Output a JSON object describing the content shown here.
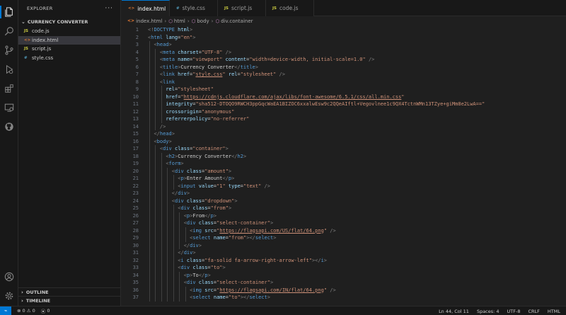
{
  "explorer": {
    "title": "EXPLORER",
    "more": "···",
    "folder": "CURRENCY CONVERTER",
    "files": [
      {
        "name": "code.js",
        "icon": "JS"
      },
      {
        "name": "index.html",
        "icon": "<>"
      },
      {
        "name": "script.js",
        "icon": "JS"
      },
      {
        "name": "style.css",
        "icon": "#"
      }
    ],
    "outline": "OUTLINE",
    "timeline": "TIMELINE"
  },
  "tabs": [
    {
      "name": "index.html",
      "icon": "<>",
      "close": "×"
    },
    {
      "name": "style.css",
      "icon": "#"
    },
    {
      "name": "script.js",
      "icon": "JS"
    },
    {
      "name": "code.js",
      "icon": "JS"
    }
  ],
  "breadcrumb": [
    "index.html",
    "html",
    "body",
    "div.container"
  ],
  "statusbar": {
    "errors": "0",
    "warnings": "0",
    "ports": "0",
    "position": "Ln 44, Col 11",
    "spaces": "Spaces: 4",
    "encoding": "UTF-8",
    "eol": "CRLF",
    "language": "HTML"
  },
  "colors": {
    "accent": "#0078d4",
    "tag": "#569cd6",
    "attribute": "#9cdcfe",
    "string": "#ce9178"
  },
  "editor": {
    "lines": [
      {
        "n": "1",
        "indent": 0,
        "tokens": [
          [
            "br",
            "<!"
          ],
          [
            "tag",
            "DOCTYPE"
          ],
          [
            "attr",
            " html"
          ],
          [
            "br",
            ">"
          ]
        ]
      },
      {
        "n": "2",
        "indent": 0,
        "tokens": [
          [
            "br",
            "<"
          ],
          [
            "tag",
            "html"
          ],
          [
            "attr",
            " lang"
          ],
          [
            "txt",
            "="
          ],
          [
            "str",
            "\"en\""
          ],
          [
            "br",
            ">"
          ]
        ]
      },
      {
        "n": "3",
        "indent": 1,
        "tokens": [
          [
            "br",
            "<"
          ],
          [
            "tag",
            "head"
          ],
          [
            "br",
            ">"
          ]
        ]
      },
      {
        "n": "4",
        "indent": 2,
        "tokens": [
          [
            "br",
            "<"
          ],
          [
            "tag",
            "meta"
          ],
          [
            "attr",
            " charset"
          ],
          [
            "txt",
            "="
          ],
          [
            "str",
            "\"UTF-8\""
          ],
          [
            "br",
            " />"
          ]
        ]
      },
      {
        "n": "5",
        "indent": 2,
        "tokens": [
          [
            "br",
            "<"
          ],
          [
            "tag",
            "meta"
          ],
          [
            "attr",
            " name"
          ],
          [
            "txt",
            "="
          ],
          [
            "str",
            "\"viewport\""
          ],
          [
            "attr",
            " content"
          ],
          [
            "txt",
            "="
          ],
          [
            "str",
            "\"width=device-width, initial-scale=1.0\""
          ],
          [
            "br",
            " />"
          ]
        ]
      },
      {
        "n": "6",
        "indent": 2,
        "tokens": [
          [
            "br",
            "<"
          ],
          [
            "tag",
            "title"
          ],
          [
            "br",
            ">"
          ],
          [
            "txt",
            "Currency Converter"
          ],
          [
            "br",
            "</"
          ],
          [
            "tag",
            "title"
          ],
          [
            "br",
            ">"
          ]
        ]
      },
      {
        "n": "7",
        "indent": 2,
        "tokens": [
          [
            "br",
            "<"
          ],
          [
            "tag",
            "link"
          ],
          [
            "attr",
            " href"
          ],
          [
            "txt",
            "="
          ],
          [
            "str",
            "\""
          ],
          [
            "link",
            "style.css"
          ],
          [
            "str",
            "\""
          ],
          [
            "attr",
            " rel"
          ],
          [
            "txt",
            "="
          ],
          [
            "str",
            "\"stylesheet\""
          ],
          [
            "br",
            " />"
          ]
        ]
      },
      {
        "n": "8",
        "indent": 2,
        "tokens": [
          [
            "br",
            "<"
          ],
          [
            "tag",
            "link"
          ]
        ]
      },
      {
        "n": "9",
        "indent": 3,
        "tokens": [
          [
            "attr",
            "rel"
          ],
          [
            "txt",
            "="
          ],
          [
            "str",
            "\"stylesheet\""
          ]
        ]
      },
      {
        "n": "10",
        "indent": 3,
        "tokens": [
          [
            "attr",
            "href"
          ],
          [
            "txt",
            "="
          ],
          [
            "str",
            "\""
          ],
          [
            "link",
            "https://cdnjs.cloudflare.com/ajax/libs/font-awesome/6.5.1/css/all.min.css"
          ],
          [
            "str",
            "\""
          ]
        ]
      },
      {
        "n": "11",
        "indent": 3,
        "tokens": [
          [
            "attr",
            "integrity"
          ],
          [
            "txt",
            "="
          ],
          [
            "str",
            "\"sha512-DTOQO9RWCH3ppGqcWaEA1BIZOC6xxalwEsw9c2QQeAIftl+Vegovlnee1c9QX4TctnWMn13TZye+giMm8e2LwA==\""
          ]
        ]
      },
      {
        "n": "12",
        "indent": 3,
        "tokens": [
          [
            "attr",
            "crossorigin"
          ],
          [
            "txt",
            "="
          ],
          [
            "str",
            "\"anonymous\""
          ]
        ]
      },
      {
        "n": "13",
        "indent": 3,
        "tokens": [
          [
            "attr",
            "referrerpolicy"
          ],
          [
            "txt",
            "="
          ],
          [
            "str",
            "\"no-referrer\""
          ]
        ]
      },
      {
        "n": "14",
        "indent": 2,
        "tokens": [
          [
            "br",
            "/>"
          ]
        ]
      },
      {
        "n": "15",
        "indent": 1,
        "tokens": [
          [
            "br",
            "</"
          ],
          [
            "tag",
            "head"
          ],
          [
            "br",
            ">"
          ]
        ]
      },
      {
        "n": "16",
        "indent": 1,
        "tokens": [
          [
            "br",
            "<"
          ],
          [
            "tag",
            "body"
          ],
          [
            "br",
            ">"
          ]
        ]
      },
      {
        "n": "17",
        "indent": 2,
        "tokens": [
          [
            "br",
            "<"
          ],
          [
            "tag",
            "div"
          ],
          [
            "attr",
            " class"
          ],
          [
            "txt",
            "="
          ],
          [
            "str",
            "\"container\""
          ],
          [
            "br",
            ">"
          ]
        ]
      },
      {
        "n": "18",
        "indent": 3,
        "tokens": [
          [
            "br",
            "<"
          ],
          [
            "tag",
            "h2"
          ],
          [
            "br",
            ">"
          ],
          [
            "txt",
            "Currency Converter"
          ],
          [
            "br",
            "</"
          ],
          [
            "tag",
            "h2"
          ],
          [
            "br",
            ">"
          ]
        ]
      },
      {
        "n": "19",
        "indent": 3,
        "tokens": [
          [
            "br",
            "<"
          ],
          [
            "tag",
            "form"
          ],
          [
            "br",
            ">"
          ]
        ]
      },
      {
        "n": "20",
        "indent": 4,
        "tokens": [
          [
            "br",
            "<"
          ],
          [
            "tag",
            "div"
          ],
          [
            "attr",
            " class"
          ],
          [
            "txt",
            "="
          ],
          [
            "str",
            "\"amount\""
          ],
          [
            "br",
            ">"
          ]
        ]
      },
      {
        "n": "21",
        "indent": 5,
        "tokens": [
          [
            "br",
            "<"
          ],
          [
            "tag",
            "p"
          ],
          [
            "br",
            ">"
          ],
          [
            "txt",
            "Enter Amount"
          ],
          [
            "br",
            "</"
          ],
          [
            "tag",
            "p"
          ],
          [
            "br",
            ">"
          ]
        ]
      },
      {
        "n": "22",
        "indent": 5,
        "tokens": [
          [
            "br",
            "<"
          ],
          [
            "tag",
            "input"
          ],
          [
            "attr",
            " value"
          ],
          [
            "txt",
            "="
          ],
          [
            "str",
            "\"1\""
          ],
          [
            "attr",
            " type"
          ],
          [
            "txt",
            "="
          ],
          [
            "str",
            "\"text\""
          ],
          [
            "br",
            " />"
          ]
        ]
      },
      {
        "n": "23",
        "indent": 4,
        "tokens": [
          [
            "br",
            "</"
          ],
          [
            "tag",
            "div"
          ],
          [
            "br",
            ">"
          ]
        ]
      },
      {
        "n": "24",
        "indent": 4,
        "tokens": [
          [
            "br",
            "<"
          ],
          [
            "tag",
            "div"
          ],
          [
            "attr",
            " class"
          ],
          [
            "txt",
            "="
          ],
          [
            "str",
            "\"dropdown\""
          ],
          [
            "br",
            ">"
          ]
        ]
      },
      {
        "n": "25",
        "indent": 5,
        "tokens": [
          [
            "br",
            "<"
          ],
          [
            "tag",
            "div"
          ],
          [
            "attr",
            " class"
          ],
          [
            "txt",
            "="
          ],
          [
            "str",
            "\"from\""
          ],
          [
            "br",
            ">"
          ]
        ]
      },
      {
        "n": "26",
        "indent": 6,
        "tokens": [
          [
            "br",
            "<"
          ],
          [
            "tag",
            "p"
          ],
          [
            "br",
            ">"
          ],
          [
            "txt",
            "From"
          ],
          [
            "br",
            "</"
          ],
          [
            "tag",
            "p"
          ],
          [
            "br",
            ">"
          ]
        ]
      },
      {
        "n": "27",
        "indent": 6,
        "tokens": [
          [
            "br",
            "<"
          ],
          [
            "tag",
            "div"
          ],
          [
            "attr",
            " class"
          ],
          [
            "txt",
            "="
          ],
          [
            "str",
            "\"select-container\""
          ],
          [
            "br",
            ">"
          ]
        ]
      },
      {
        "n": "28",
        "indent": 7,
        "tokens": [
          [
            "br",
            "<"
          ],
          [
            "tag",
            "img"
          ],
          [
            "attr",
            " src"
          ],
          [
            "txt",
            "="
          ],
          [
            "str",
            "\""
          ],
          [
            "link",
            "https://flagsapi.com/US/flat/64.png"
          ],
          [
            "str",
            "\""
          ],
          [
            "br",
            " />"
          ]
        ]
      },
      {
        "n": "29",
        "indent": 7,
        "tokens": [
          [
            "br",
            "<"
          ],
          [
            "tag",
            "select"
          ],
          [
            "attr",
            " name"
          ],
          [
            "txt",
            "="
          ],
          [
            "str",
            "\"from\""
          ],
          [
            "br",
            "></"
          ],
          [
            "tag",
            "select"
          ],
          [
            "br",
            ">"
          ]
        ]
      },
      {
        "n": "30",
        "indent": 6,
        "tokens": [
          [
            "br",
            "</"
          ],
          [
            "tag",
            "div"
          ],
          [
            "br",
            ">"
          ]
        ]
      },
      {
        "n": "31",
        "indent": 5,
        "tokens": [
          [
            "br",
            "</"
          ],
          [
            "tag",
            "div"
          ],
          [
            "br",
            ">"
          ]
        ]
      },
      {
        "n": "32",
        "indent": 5,
        "tokens": [
          [
            "br",
            "<"
          ],
          [
            "tag",
            "i"
          ],
          [
            "attr",
            " class"
          ],
          [
            "txt",
            "="
          ],
          [
            "str",
            "\"fa-solid fa-arrow-right-arrow-left\""
          ],
          [
            "br",
            "></"
          ],
          [
            "tag",
            "i"
          ],
          [
            "br",
            ">"
          ]
        ]
      },
      {
        "n": "33",
        "indent": 5,
        "tokens": [
          [
            "br",
            "<"
          ],
          [
            "tag",
            "div"
          ],
          [
            "attr",
            " class"
          ],
          [
            "txt",
            "="
          ],
          [
            "str",
            "\"to\""
          ],
          [
            "br",
            ">"
          ]
        ]
      },
      {
        "n": "34",
        "indent": 6,
        "tokens": [
          [
            "br",
            "<"
          ],
          [
            "tag",
            "p"
          ],
          [
            "br",
            ">"
          ],
          [
            "txt",
            "To"
          ],
          [
            "br",
            "</"
          ],
          [
            "tag",
            "p"
          ],
          [
            "br",
            ">"
          ]
        ]
      },
      {
        "n": "35",
        "indent": 6,
        "tokens": [
          [
            "br",
            "<"
          ],
          [
            "tag",
            "div"
          ],
          [
            "attr",
            " class"
          ],
          [
            "txt",
            "="
          ],
          [
            "str",
            "\"select-container\""
          ],
          [
            "br",
            ">"
          ]
        ]
      },
      {
        "n": "36",
        "indent": 7,
        "tokens": [
          [
            "br",
            "<"
          ],
          [
            "tag",
            "img"
          ],
          [
            "attr",
            " src"
          ],
          [
            "txt",
            "="
          ],
          [
            "str",
            "\""
          ],
          [
            "link",
            "https://flagsapi.com/IN/flat/64.png"
          ],
          [
            "str",
            "\""
          ],
          [
            "br",
            " />"
          ]
        ]
      },
      {
        "n": "37",
        "indent": 7,
        "tokens": [
          [
            "br",
            "<"
          ],
          [
            "tag",
            "select"
          ],
          [
            "attr",
            " name"
          ],
          [
            "txt",
            "="
          ],
          [
            "str",
            "\"to\""
          ],
          [
            "br",
            "></"
          ],
          [
            "tag",
            "select"
          ],
          [
            "br",
            ">"
          ]
        ]
      }
    ]
  }
}
